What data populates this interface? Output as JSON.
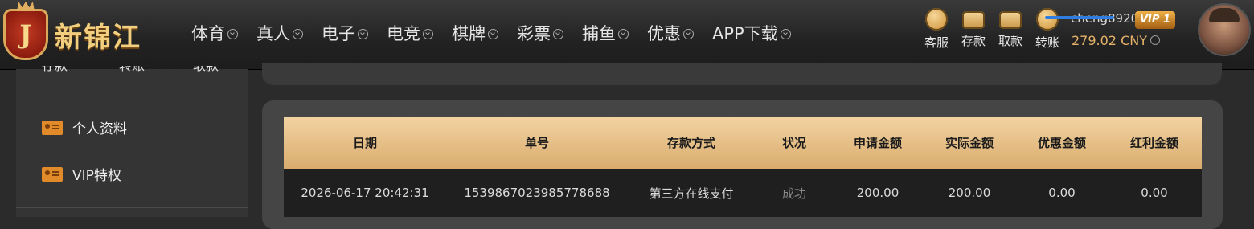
{
  "brand": {
    "name": "新锦江",
    "badge_letter": "J"
  },
  "nav": [
    {
      "label": "体育"
    },
    {
      "label": "真人"
    },
    {
      "label": "电子"
    },
    {
      "label": "电竞"
    },
    {
      "label": "棋牌"
    },
    {
      "label": "彩票"
    },
    {
      "label": "捕鱼"
    },
    {
      "label": "优惠"
    },
    {
      "label": "APP下载"
    }
  ],
  "quick_actions": [
    {
      "label": "客服",
      "icon": "customer-service-icon"
    },
    {
      "label": "存款",
      "icon": "wallet-icon"
    },
    {
      "label": "取款",
      "icon": "card-icon"
    },
    {
      "label": "转账",
      "icon": "transfer-icon"
    }
  ],
  "user": {
    "username": "cheng8920",
    "vip": "VIP 1",
    "balance": "279.02 CNY"
  },
  "sidebar": {
    "cut_labels": [
      "存款",
      "转账",
      "取款"
    ],
    "items": [
      {
        "label": "个人资料",
        "icon": "id-card-icon"
      },
      {
        "label": "VIP特权",
        "icon": "id-card-icon"
      }
    ]
  },
  "table": {
    "headers": [
      "日期",
      "单号",
      "存款方式",
      "状况",
      "申请金额",
      "实际金额",
      "优惠金额",
      "红利金额"
    ],
    "rows": [
      [
        "2026-06-17 20:42:31",
        "1539867023985778688",
        "第三方在线支付",
        "成功",
        "200.00",
        "200.00",
        "0.00",
        "0.00"
      ]
    ]
  },
  "colors": {
    "accent_gold": "#e5b36a",
    "header_bg": "#222222",
    "table_head": "#e8c48c",
    "vip_badge": "#c97a1e"
  }
}
